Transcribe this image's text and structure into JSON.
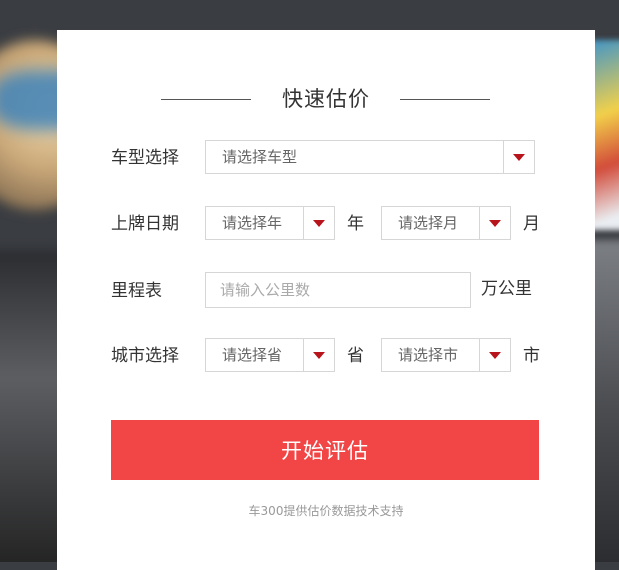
{
  "title": "快速估价",
  "car_model": {
    "label": "车型选择",
    "placeholder": "请选择车型"
  },
  "plate_date": {
    "label": "上牌日期",
    "year_placeholder": "请选择年",
    "year_unit": "年",
    "month_placeholder": "请选择月",
    "month_unit": "月"
  },
  "mileage": {
    "label": "里程表",
    "placeholder": "请输入公里数",
    "unit": "万公里"
  },
  "city": {
    "label": "城市选择",
    "province_placeholder": "请选择省",
    "province_unit": "省",
    "city_placeholder": "请选择市",
    "city_unit": "市"
  },
  "submit_label": "开始评估",
  "footnote": "车300提供估价数据技术支持",
  "colors": {
    "accent": "#f24646",
    "arrow": "#b8141c"
  }
}
